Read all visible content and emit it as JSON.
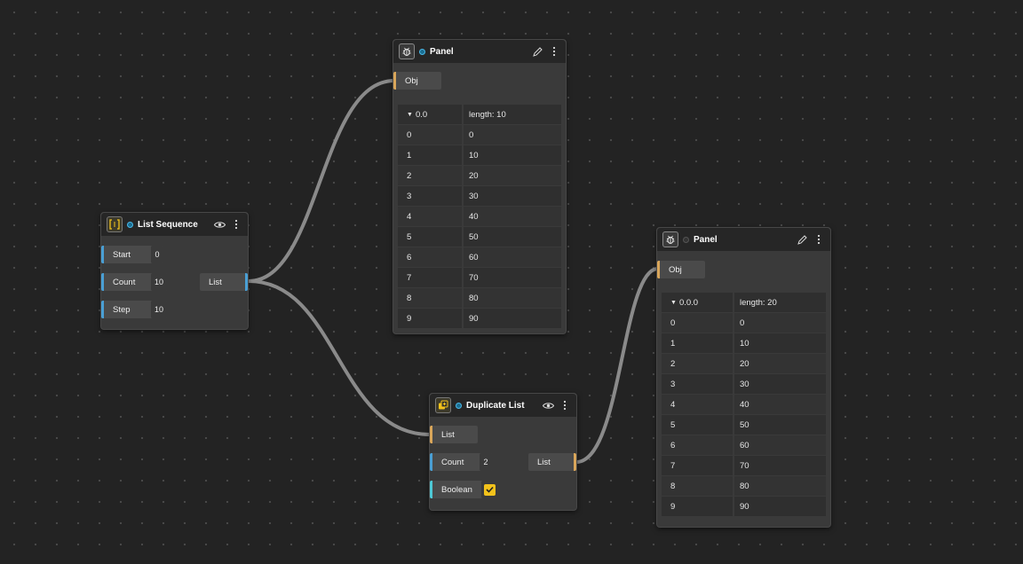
{
  "nodes": {
    "list_sequence": {
      "title": "List Sequence",
      "icon": "list-sequence-icon",
      "inputs": [
        {
          "label": "Start",
          "value": "0"
        },
        {
          "label": "Count",
          "value": "10"
        },
        {
          "label": "Step",
          "value": "10"
        }
      ],
      "output": "List"
    },
    "panel1": {
      "title": "Panel",
      "icon": "bug-icon",
      "input": "Obj",
      "path": "0.0",
      "length": "length: 10",
      "rows": [
        [
          "0",
          "0"
        ],
        [
          "1",
          "10"
        ],
        [
          "2",
          "20"
        ],
        [
          "3",
          "30"
        ],
        [
          "4",
          "40"
        ],
        [
          "5",
          "50"
        ],
        [
          "6",
          "60"
        ],
        [
          "7",
          "70"
        ],
        [
          "8",
          "80"
        ],
        [
          "9",
          "90"
        ]
      ]
    },
    "duplicate_list": {
      "title": "Duplicate List",
      "icon": "duplicate-icon",
      "inputs": [
        {
          "label": "List"
        },
        {
          "label": "Count",
          "value": "2"
        },
        {
          "label": "Boolean",
          "checked": true
        }
      ],
      "output": "List"
    },
    "panel2": {
      "title": "Panel",
      "icon": "bug-icon",
      "input": "Obj",
      "path": "0.0.0",
      "length": "length: 20",
      "rows": [
        [
          "0",
          "0"
        ],
        [
          "1",
          "10"
        ],
        [
          "2",
          "20"
        ],
        [
          "3",
          "30"
        ],
        [
          "4",
          "40"
        ],
        [
          "5",
          "50"
        ],
        [
          "6",
          "60"
        ],
        [
          "7",
          "70"
        ],
        [
          "8",
          "80"
        ],
        [
          "9",
          "90"
        ]
      ]
    }
  },
  "colors": {
    "background": "#232323",
    "wire": "#8a8a8a",
    "pin_blue": "#4a9fd4",
    "pin_orange": "#d9a65a",
    "pin_cyan": "#4ec9d6",
    "checkbox": "#f2c21b"
  }
}
